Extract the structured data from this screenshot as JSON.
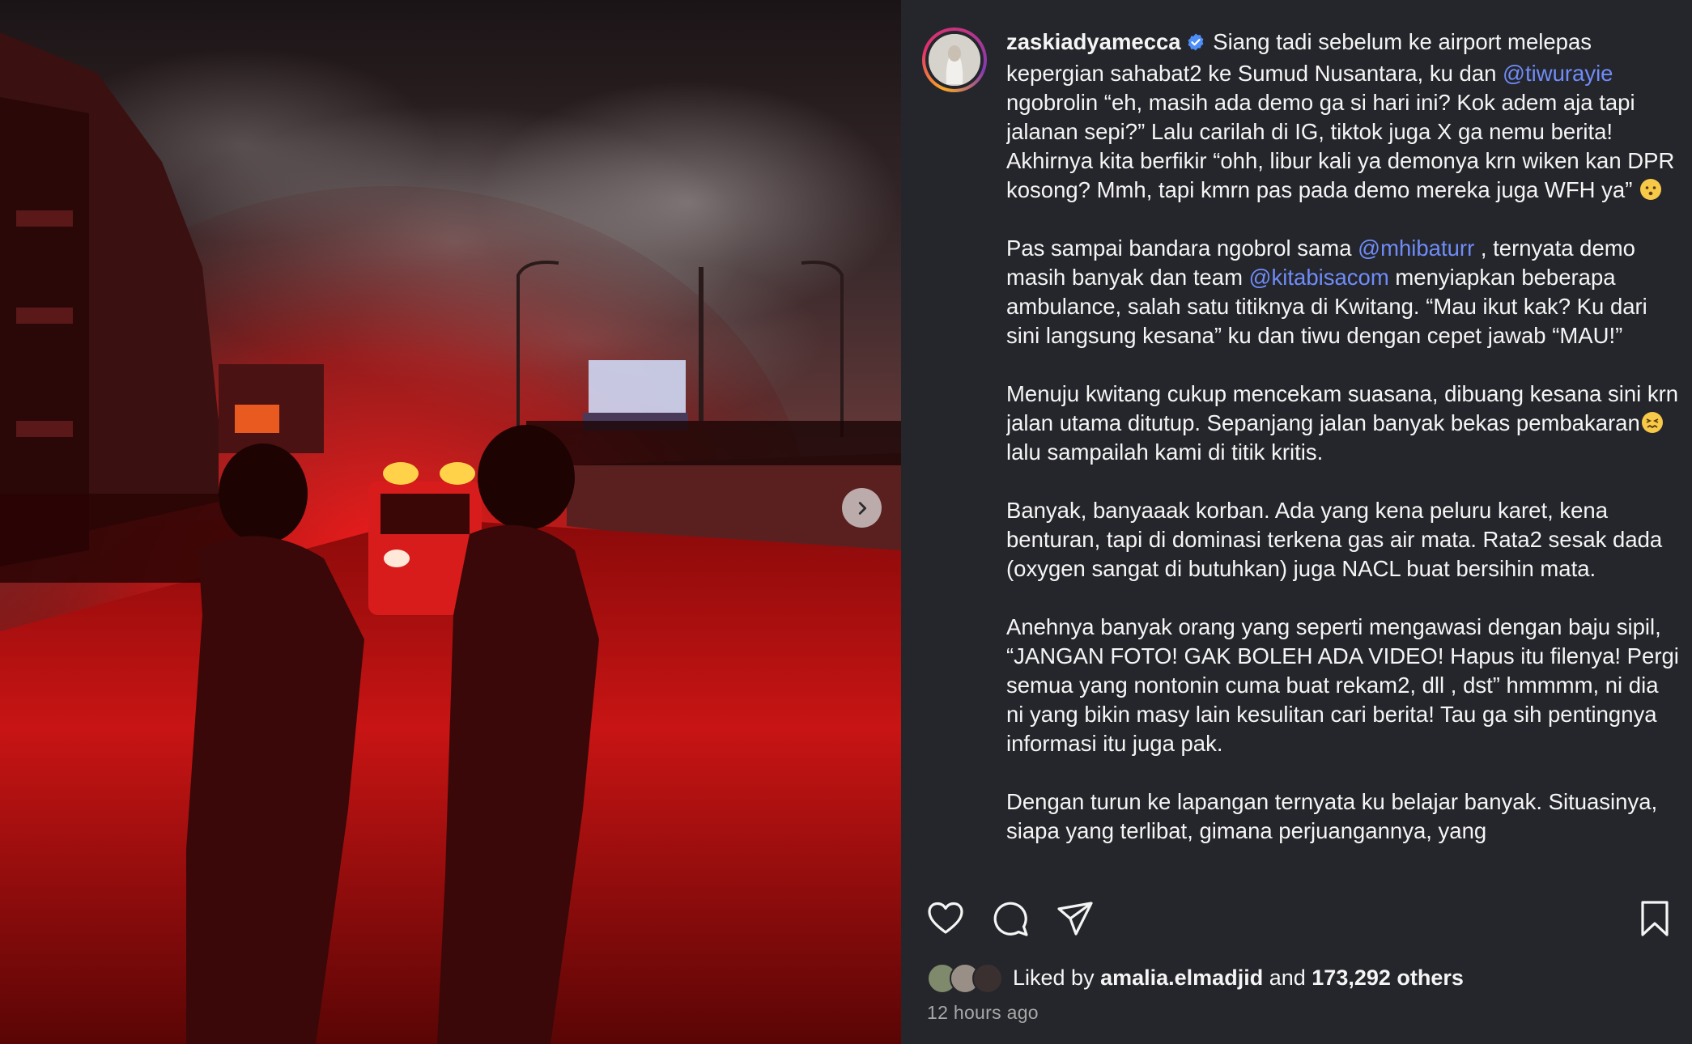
{
  "post": {
    "username": "zaskiadyamecca",
    "verified": true,
    "caption": {
      "p1": {
        "a": "Siang tadi sebelum ke airport melepas kepergian sahabat2 ke Sumud Nusantara, ku dan ",
        "mention": "@tiwurayie",
        "b": " ngobrolin “eh, masih ada demo ga si hari ini? Kok adem aja tapi jalanan sepi?” Lalu carilah di IG, tiktok juga X ga nemu berita! Akhirnya kita berfikir “ohh, libur kali ya demonya krn wiken kan DPR kosong? Mmh, tapi kmrn pas pada demo mereka juga WFH ya” ",
        "emoji": "hushed-face-emoji"
      },
      "p2": {
        "a": "Pas sampai bandara ngobrol sama ",
        "mention1": "@mhibaturr",
        "b": " , ternyata demo masih banyak dan team ",
        "mention2": "@kitabisacom",
        "c": " menyiapkan beberapa ambulance, salah satu titiknya di Kwitang. “Mau ikut kak? Ku dari sini langsung kesana” ku dan tiwu dengan cepet jawab “MAU!”"
      },
      "p3": {
        "a": "Menuju kwitang cukup mencekam suasana, dibuang kesana sini krn jalan utama ditutup. Sepanjang jalan banyak bekas pembakaran",
        "emoji": "confounded-face-emoji",
        "b": " lalu sampailah kami di titik kritis."
      },
      "p4": "Banyak, banyaaak korban. Ada yang kena peluru karet, kena benturan, tapi di dominasi terkena gas air mata. Rata2 sesak dada (oxygen sangat di butuhkan) juga NACL buat bersihin mata.",
      "p5": "Anehnya banyak orang yang seperti mengawasi dengan baju sipil, “JANGAN FOTO! GAK BOLEH ADA VIDEO! Hapus itu filenya! Pergi semua yang nontonin cuma buat rekam2, dll , dst” hmmmm, ni dia ni yang bikin masy lain kesulitan cari berita! Tau ga sih pentingnya informasi itu juga pak.",
      "p6": "Dengan turun ke lapangan ternyata ku belajar banyak. Situasinya, siapa yang terlibat, gimana perjuangannya, yang"
    },
    "likes": {
      "prefix": "Liked by",
      "liker": "amalia.elmadjid",
      "and": "and",
      "others": "173,292 others"
    },
    "timestamp": "12 hours ago"
  },
  "icons": {
    "like": "heart-icon",
    "comment": "comment-icon",
    "share": "paper-plane-icon",
    "save": "bookmark-icon",
    "next": "chevron-right-icon",
    "verified": "verified-badge-icon"
  },
  "colors": {
    "background": "#25262b",
    "mention": "#6f8cf8",
    "text": "#f5f5f5",
    "muted": "#a8a8a8",
    "verified": "#4e8ef7"
  }
}
